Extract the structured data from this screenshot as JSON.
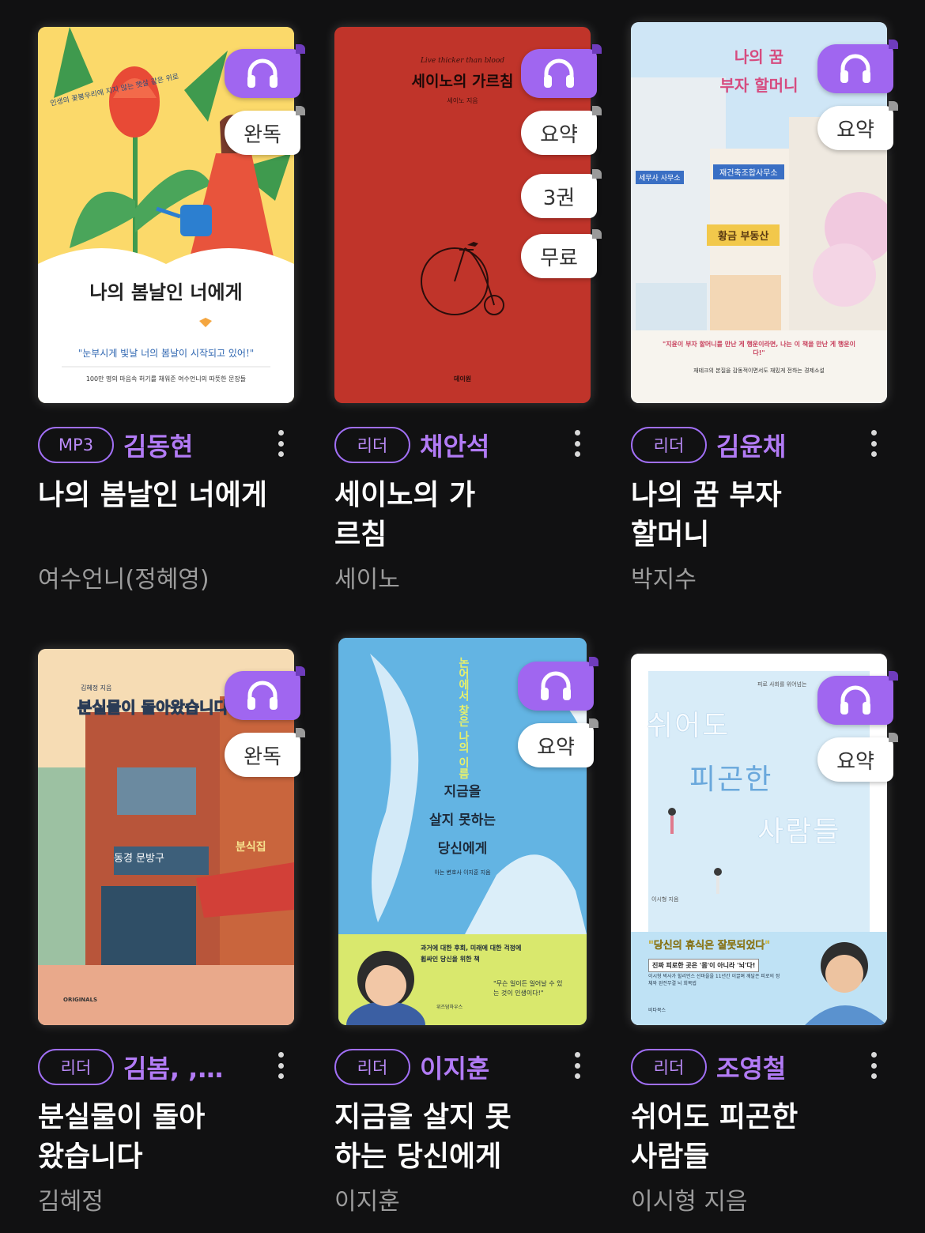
{
  "books": [
    {
      "tag": "MP3",
      "narrator": "김동현",
      "title": "나의 봄날인 너에게",
      "author": "여수언니(정혜영)",
      "badges": [
        "완독"
      ],
      "cover": {
        "title": "나의 봄날인 너에게",
        "tagline": "인생의 꽃봉우리에 지지 않는 햇살 같은 위로",
        "quote": "\"눈부시게 빛날 너의 봄날이 시작되고 있어!\"",
        "footer": "100만 명의 마음속 허기를 채워준 여수언니의 따뜻한 문장들"
      }
    },
    {
      "tag": "리더",
      "narrator": "채안석",
      "title": "세이노의 가르침",
      "author": "세이노",
      "badges": [
        "요약",
        "3권",
        "무료"
      ],
      "cover": {
        "top": "Live thicker than blood",
        "title": "세이노의 가르침",
        "sub": "세이노 지음",
        "publisher": "데이원"
      }
    },
    {
      "tag": "리더",
      "narrator": "김윤채",
      "title": "나의 꿈 부자 할머니",
      "author": "박지수",
      "badges": [
        "요약"
      ],
      "cover": {
        "title1": "나의 꿈",
        "title2": "부자 할머니",
        "sign1": "세무사 사무소",
        "sign2": "재건축조합사무소",
        "sign3": "황금 부동산",
        "quote": "\"지윤이 부자 할머니를 만난 게 행운이라면, 나는 이 책을 만난 게 행운이다!\"",
        "footer": "재테크의 본질을 감동적이면서도 재밌게 전하는 경제소설"
      }
    },
    {
      "tag": "리더",
      "narrator": "김봄, ,…",
      "title": "분실물이 돌아왔습니다",
      "author": "김혜정",
      "badges": [
        "완독"
      ],
      "cover": {
        "author_line": "김혜정 지음",
        "title": "분실물이 돌아왔습니다",
        "shop1": "동경 문방구",
        "shop2": "분식집",
        "label": "ORIGINALS"
      }
    },
    {
      "tag": "리더",
      "narrator": "이지훈",
      "title": "지금을 살지 못하는 당신에게",
      "author": "이지훈",
      "badges": [
        "요약"
      ],
      "cover": {
        "vertical": "논어에서 찾은 나의 이름",
        "title1": "지금을",
        "title2": "살지 못하는",
        "title3": "당신에게",
        "sub": "아는 변호사 이지훈 지음",
        "blurb": "과거에 대한 후회, 미래에 대한 걱정에 휩싸인 당신을 위한 책",
        "quote": "\"무슨 일이든 일어날 수 있는 것이 인생이다!\"",
        "publisher": "위즈덤하우스"
      }
    },
    {
      "tag": "리더",
      "narrator": "조영철",
      "title": "쉬어도 피곤한 사람들",
      "author": "이시형 지음",
      "badges": [
        "요약"
      ],
      "cover": {
        "top": "피로 사회를 위어넘는",
        "title1": "쉬어도",
        "title2": "피곤한",
        "title3": "사람들",
        "author_line": "이시형 지음",
        "quote": "\"당신의 휴식은 잘못되었다\"",
        "box": "진짜 피로한 곳은 '몸'이 아니라 '뇌'다!",
        "footer": "이시형 박사가 힐리언스 선마을을 11년간 이끌며 깨달은 피로의 정체와 완전무결 뇌 회복법",
        "publisher": "비타북스"
      }
    }
  ]
}
